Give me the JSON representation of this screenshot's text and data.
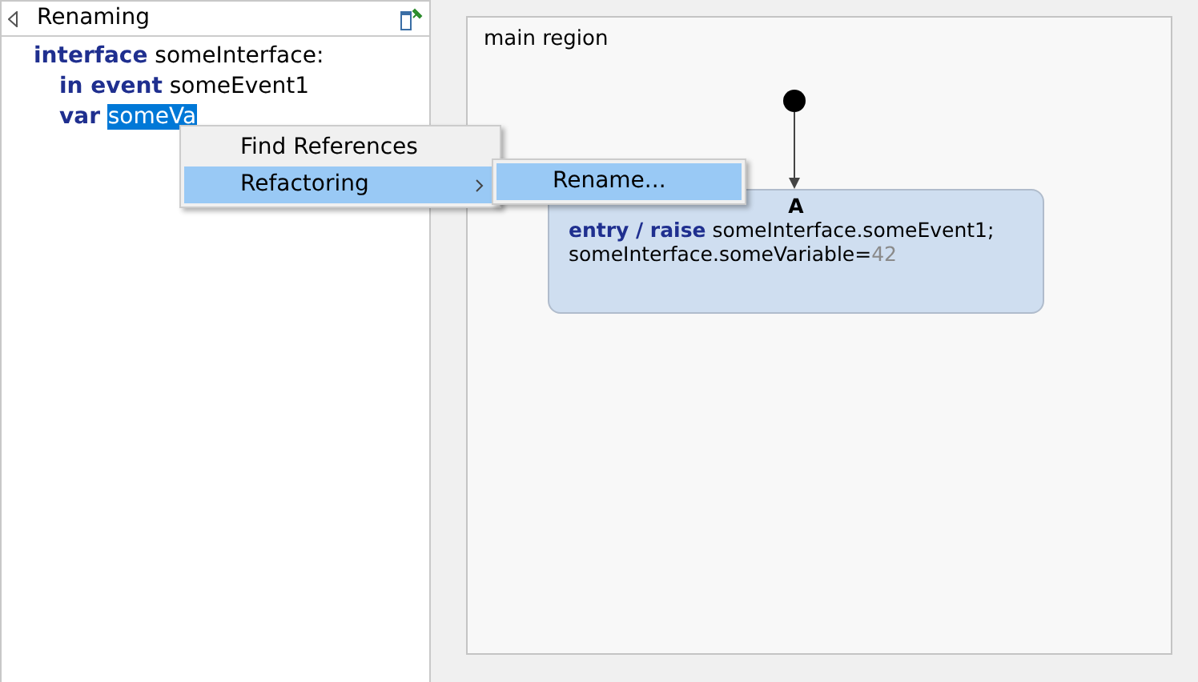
{
  "outline": {
    "title": "Renaming",
    "lines": [
      {
        "parts": [
          {
            "kind": "keyword",
            "text": "interface"
          },
          {
            "kind": "plain",
            "text": " someInterface:"
          }
        ],
        "children": [
          {
            "parts": [
              {
                "kind": "keyword",
                "text": "in event"
              },
              {
                "kind": "plain",
                "text": " someEvent1"
              }
            ]
          },
          {
            "parts": [
              {
                "kind": "keyword",
                "text": "var "
              },
              {
                "kind": "selected",
                "text": "someVa"
              }
            ]
          }
        ]
      }
    ]
  },
  "context_menu": {
    "items": [
      {
        "label": "Find References",
        "submenu": false,
        "selected": false
      },
      {
        "label": "Refactoring",
        "submenu": true,
        "selected": true
      }
    ]
  },
  "submenu": {
    "items": [
      {
        "label": "Rename...",
        "selected": true
      }
    ]
  },
  "diagram": {
    "region": "main region",
    "state": {
      "name": "A",
      "lines": [
        [
          {
            "kind": "keyword",
            "text": "entry / raise"
          },
          {
            "kind": "plain",
            "text": " someInterface.someEvent1;"
          }
        ],
        [
          {
            "kind": "plain",
            "text": " someInterface.someVariable="
          },
          {
            "kind": "literal",
            "text": "42"
          }
        ]
      ]
    }
  }
}
